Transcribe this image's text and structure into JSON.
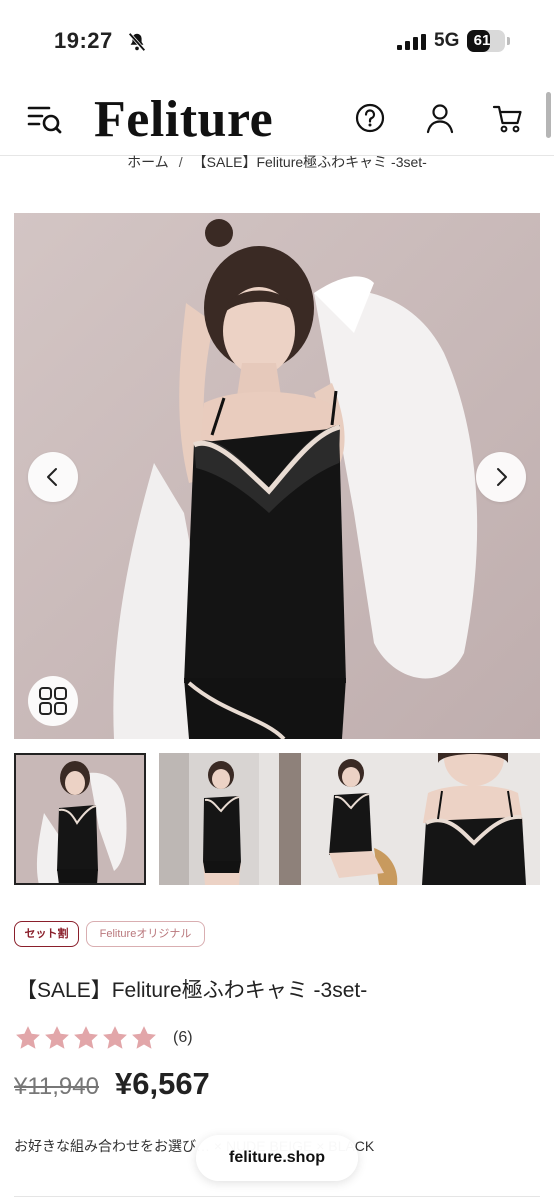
{
  "status_bar": {
    "time": "19:27",
    "network": "5G",
    "battery_level": 61,
    "battery_text": "61",
    "icons": [
      "bell-off-icon",
      "signal-icon",
      "battery-icon"
    ]
  },
  "header": {
    "logo": "Feliture",
    "icons": [
      "menu-search-icon",
      "help-icon",
      "account-icon",
      "cart-icon"
    ]
  },
  "breadcrumb": {
    "home": "ホーム",
    "separator": "/",
    "current": "【SALE】Feliture極ふわキャミ -3set-"
  },
  "gallery": {
    "active_index": 0,
    "thumbnail_count": 4,
    "icons": [
      "chevron-left-icon",
      "chevron-right-icon",
      "grid-icon"
    ]
  },
  "tags": {
    "set_discount": "セット割",
    "original": "Felitureオリジナル"
  },
  "product": {
    "title": "【SALE】Feliture極ふわキャミ -3set-",
    "rating": 5,
    "review_count": "(6)",
    "price_original": "¥11,940",
    "price_sale": "¥6,567",
    "variant_text": "お好きな組み合わせをお選び… × NUDE BEIGE × BLACK"
  },
  "browser": {
    "url": "feliture.shop"
  },
  "colors": {
    "tag_red": "#8a1f2b",
    "tag_pink": "#b9777c",
    "star": "#e2a6a9",
    "text": "#222222"
  }
}
